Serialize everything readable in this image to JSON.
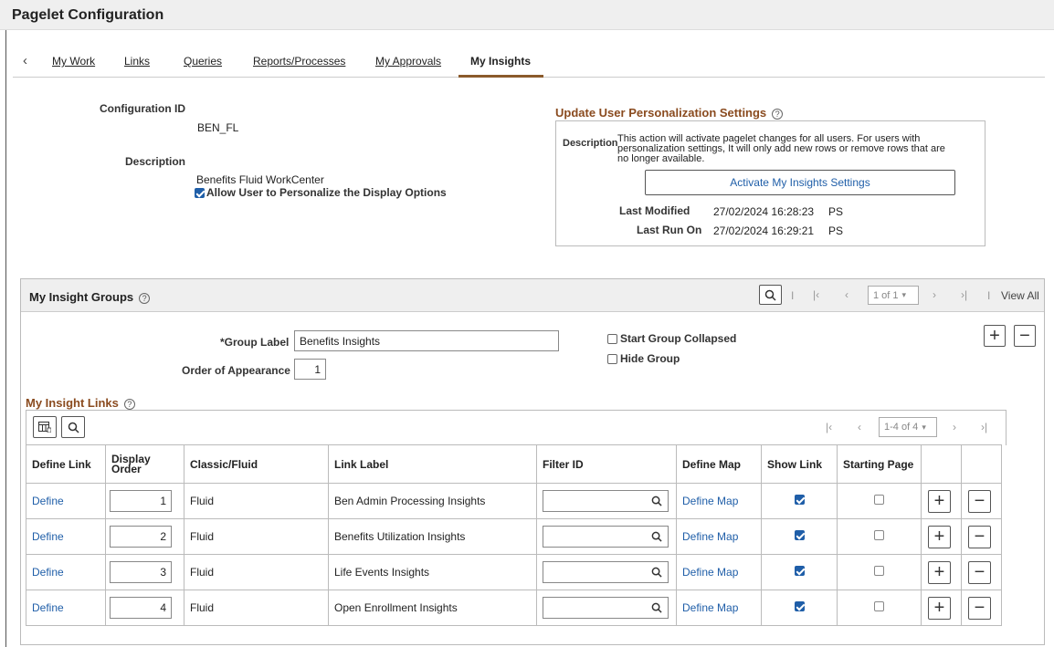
{
  "page": {
    "title": "Pagelet Configuration"
  },
  "tabs": [
    "My Work",
    "Links",
    "Queries",
    "Reports/Processes",
    "My Approvals",
    "My Insights"
  ],
  "config": {
    "config_id_label": "Configuration ID",
    "config_id_value": "BEN_FL",
    "description_label": "Description",
    "description_value": "Benefits Fluid WorkCenter",
    "allow_personalize_label": "Allow User to Personalize the Display Options",
    "allow_personalize_checked": true
  },
  "update": {
    "title": "Update User Personalization Settings",
    "description_label": "Description",
    "description_line1": "This action will activate pagelet changes for all users.  For users with",
    "description_line2": "personalization settings, It will only add new rows or remove rows that are",
    "description_line3": "no longer available.",
    "activate_button": "Activate My Insights Settings",
    "last_modified_label": "Last Modified",
    "last_modified_value": "27/02/2024 16:28:23",
    "last_modified_user": "PS",
    "last_run_label": "Last Run On",
    "last_run_value": "27/02/2024 16:29:21",
    "last_run_user": "PS"
  },
  "groups": {
    "title": "My Insight Groups",
    "pager": "1 of 1",
    "view_all": "View All",
    "group_label_label": "*Group Label",
    "group_label_value": "Benefits Insights",
    "order_label": "Order of Appearance",
    "order_value": "1",
    "start_collapsed_label": "Start Group Collapsed",
    "hide_group_label": "Hide Group"
  },
  "links": {
    "title": "My Insight Links",
    "pager": "1-4 of 4",
    "columns": [
      "Define Link",
      "Display Order",
      "Classic/Fluid",
      "Link Label",
      "Filter ID",
      "Define Map",
      "Show Link",
      "Starting Page"
    ],
    "rows": [
      {
        "define": "Define",
        "order": "1",
        "type": "Fluid",
        "label": "Ben Admin Processing Insights",
        "filter": "",
        "map": "Define Map",
        "show": true,
        "starting": false
      },
      {
        "define": "Define",
        "order": "2",
        "type": "Fluid",
        "label": "Benefits Utilization Insights",
        "filter": "",
        "map": "Define Map",
        "show": true,
        "starting": false
      },
      {
        "define": "Define",
        "order": "3",
        "type": "Fluid",
        "label": "Life Events Insights",
        "filter": "",
        "map": "Define Map",
        "show": true,
        "starting": false
      },
      {
        "define": "Define",
        "order": "4",
        "type": "Fluid",
        "label": "Open Enrollment Insights",
        "filter": "",
        "map": "Define Map",
        "show": true,
        "starting": false
      }
    ]
  },
  "colors": {
    "accent_brown": "#8a4b1f",
    "link_blue": "#1f5ea8",
    "tab_underline": "#8a5a2b"
  },
  "icons": {
    "back": "chevron-left-icon",
    "search": "search-icon",
    "add": "plus-icon",
    "remove": "minus-icon",
    "help": "help-circle-icon"
  }
}
